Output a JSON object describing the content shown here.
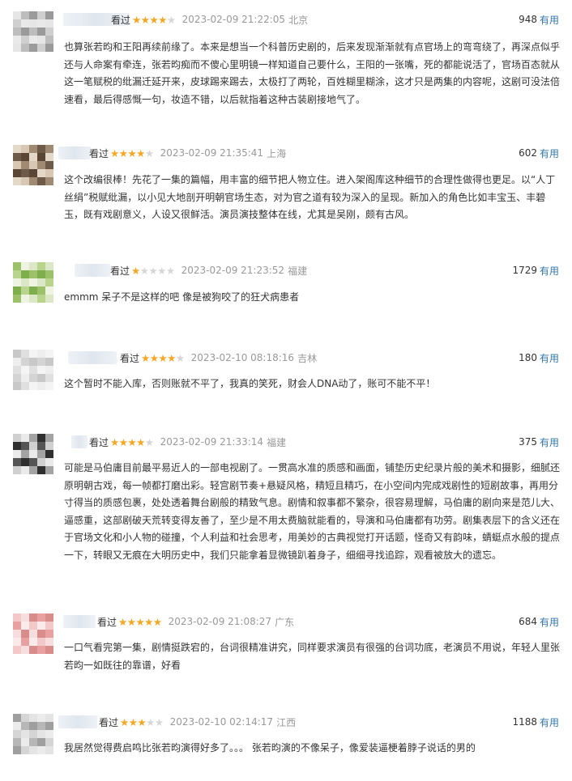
{
  "useful_label": "有用",
  "seen_label": "看过",
  "colors": {
    "star_on": "#f5a623",
    "star_off": "#d6d6d6",
    "link": "#3377aa",
    "meta": "#999999"
  },
  "reviews": [
    {
      "rating_stars": 4,
      "time": "2023-02-09 21:22:05",
      "location": "北京",
      "useful_count": "948",
      "text": "也算张若昀和王阳再续前缘了。本来是想当一个科普历史剧的，后来发现渐渐就有点官场上的弯弯绕了，再深点似乎还与人命案有牵连，张若昀痴而不傻心里明镜一样知道自己要什么，王阳的一张嘴，死的都能说活了，官场百态就从这一笔赋税的纰漏迁延开来，皮球踢来踢去，太极打了两轮，百姓糊里糊涂，这才只是两集的内容呢，这剧可没法倍速看，最后得感慨一句，妆造不错，以后就指着这种古装剧接地气了。"
    },
    {
      "rating_stars": 4,
      "time": "2023-02-09 21:35:41",
      "location": "上海",
      "useful_count": "602",
      "text": "这个改编很棒！先花了一集的篇幅，用丰富的细节把人物立住。进入架阁库这种细节的合理性做得也更足。以“人丁丝绢”税赋纰漏，以小见大地剖开明朝官场生态，对为官之道有较为深入的呈现。新加入的角色比如丰宝玉、丰碧玉，既有戏剧意义，人设又很鲜活。演员演技整体在线，尤其是吴刚，颇有古风。"
    },
    {
      "rating_stars": 1,
      "time": "2023-02-09 21:23:52",
      "location": "福建",
      "useful_count": "1729",
      "text": "emmm 呆子不是这样的吧 像是被狗咬了的狂犬病患者"
    },
    {
      "rating_stars": 4,
      "time": "2023-02-10 08:18:16",
      "location": "吉林",
      "useful_count": "180",
      "text": "这个暂时不能入库，否则账就不平了，我真的笑死，财会人DNA动了，账可不能不平！"
    },
    {
      "rating_stars": 4,
      "time": "2023-02-09 21:33:14",
      "location": "福建",
      "useful_count": "375",
      "text": "可能是马伯庸目前最平易近人的一部电视剧了。一贯高水准的质感和画面，铺垫历史纪录片般的美术和摄影，细腻还原明朝古戏，每一帧都打磨出彩。轻宫剧节奏+悬疑风格，精短且精巧，在小空间内完成戏剧性的短剧故事，再用分寸得当的质感包裹，处处透着舞台剧般的精致气息。剧情和叙事都不繁杂，很容易理解，马伯庸的剧向来是范儿大、逼感重，这部剧破天荒转变得友善了，至少是不用太费脑就能看的，导演和马伯庸都有功劳。剧集表层下的含义还在于官场文化和小人物的碰撞，个人利益和社会思考，用美妙的古典视觉打开话题，怪奇又有韵味，蜻蜓点水般的提点一下，转眼又无痕在大明历史中，我们只能拿着显微镜趴着身子，细细寻找追踪，观看被放大的遗忘。"
    },
    {
      "rating_stars": 5,
      "time": "2023-02-09 21:08:27",
      "location": "广东",
      "useful_count": "684",
      "text": "一口气看完第一集，剧情挺跌宕的，台词很精准讲究，同样要求演员有很强的台词功底，老演员不用说，年轻人里张若昀一如既往的靠谱，好看"
    },
    {
      "rating_stars": 3,
      "time": "2023-02-10 02:14:17",
      "location": "江西",
      "useful_count": "1188",
      "text": "我居然觉得费启鸣比张若昀演得好多了。。。 张若昀演的不像呆子，像爱装逼梗着脖子说话的男的"
    }
  ]
}
